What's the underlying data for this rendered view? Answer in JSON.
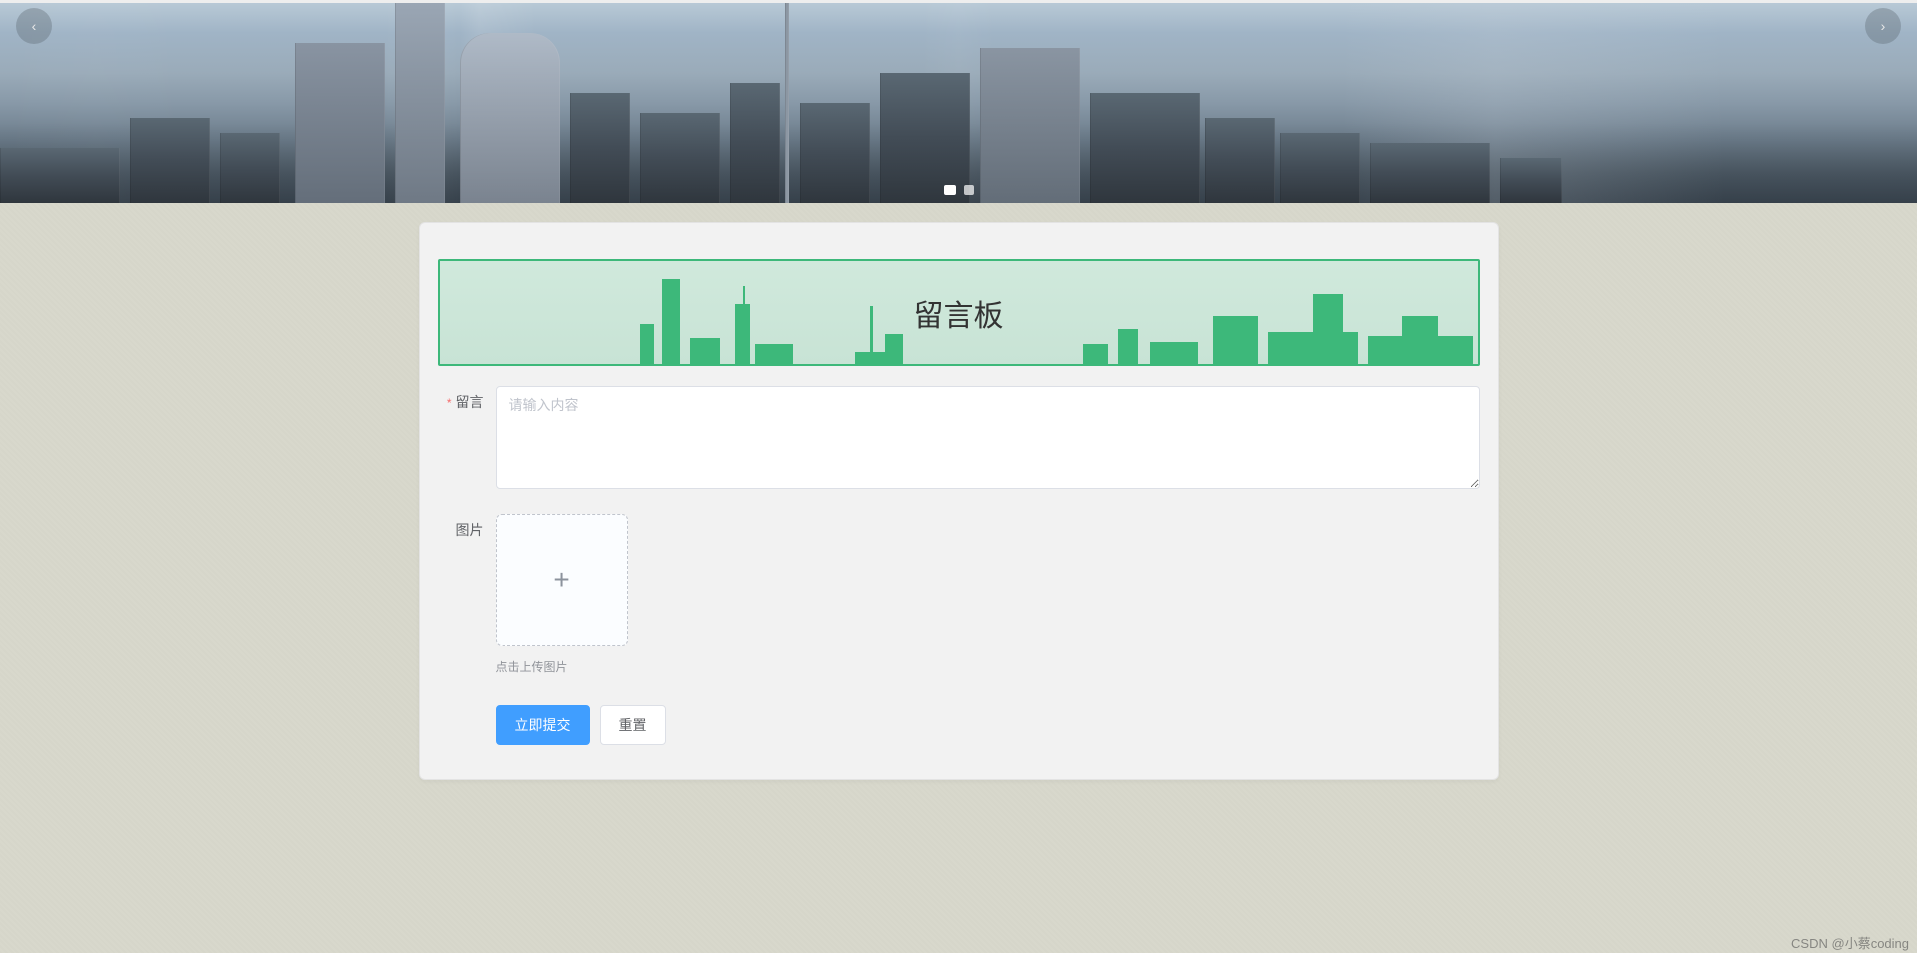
{
  "banner": {
    "prev_label": "‹",
    "next_label": "›"
  },
  "card": {
    "title": "留言板"
  },
  "form": {
    "message": {
      "label": "留言",
      "required_mark": "*",
      "placeholder": "请输入内容",
      "value": ""
    },
    "image": {
      "label": "图片",
      "upload_symbol": "+",
      "tip": "点击上传图片"
    },
    "buttons": {
      "submit": "立即提交",
      "reset": "重置"
    }
  },
  "watermark": "CSDN @小蔡coding"
}
